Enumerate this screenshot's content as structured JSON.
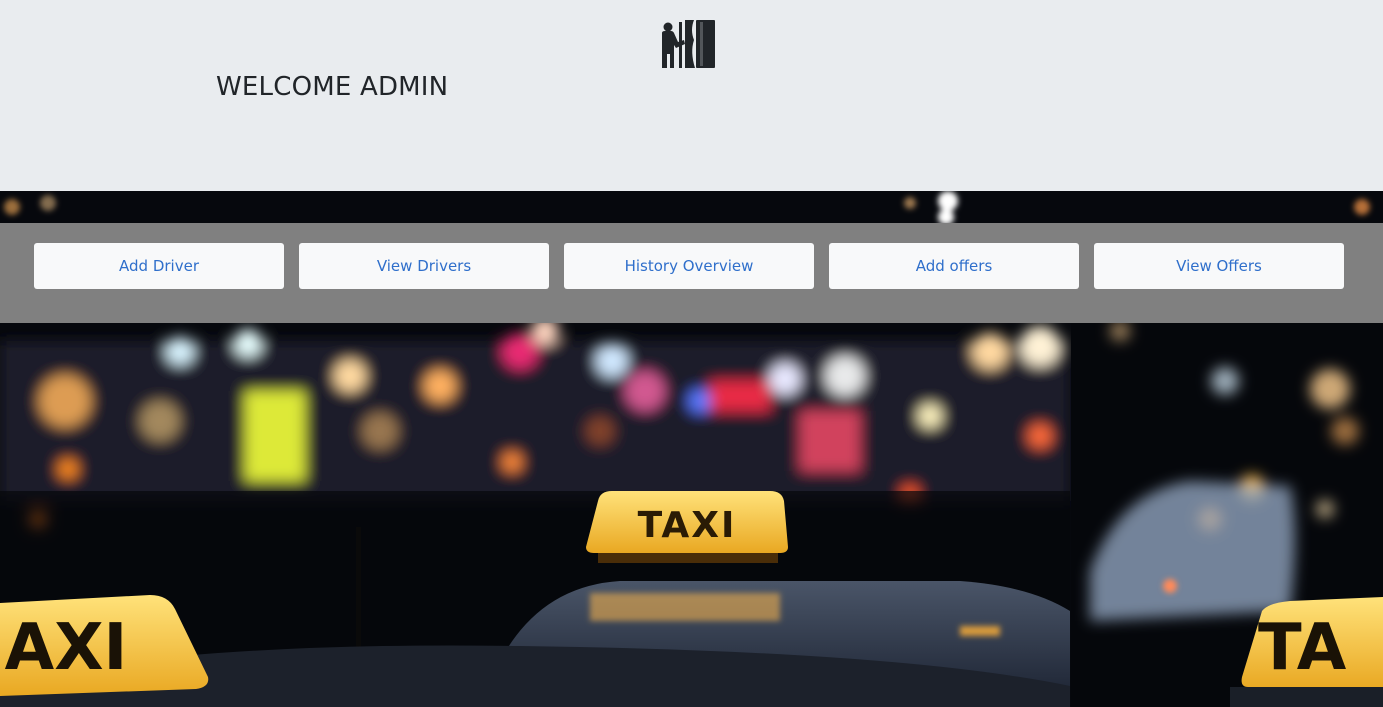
{
  "header": {
    "welcome_text": "WELCOME ADMIN",
    "logo_icon": "taxi-admin-logo-icon"
  },
  "nav": {
    "items": [
      {
        "label": "Add Driver"
      },
      {
        "label": "View Drivers"
      },
      {
        "label": "History Overview"
      },
      {
        "label": "Add offers"
      },
      {
        "label": "View Offers"
      }
    ]
  },
  "background": {
    "sign_center": "TAXI",
    "sign_left": "AXI",
    "sign_right": "TA"
  },
  "colors": {
    "header_bg": "#e9ecef",
    "nav_bg": "#808080",
    "button_bg": "#f8f9fa",
    "link_blue": "#2f6fcb",
    "taxi_yellow": "#f6c33a"
  }
}
